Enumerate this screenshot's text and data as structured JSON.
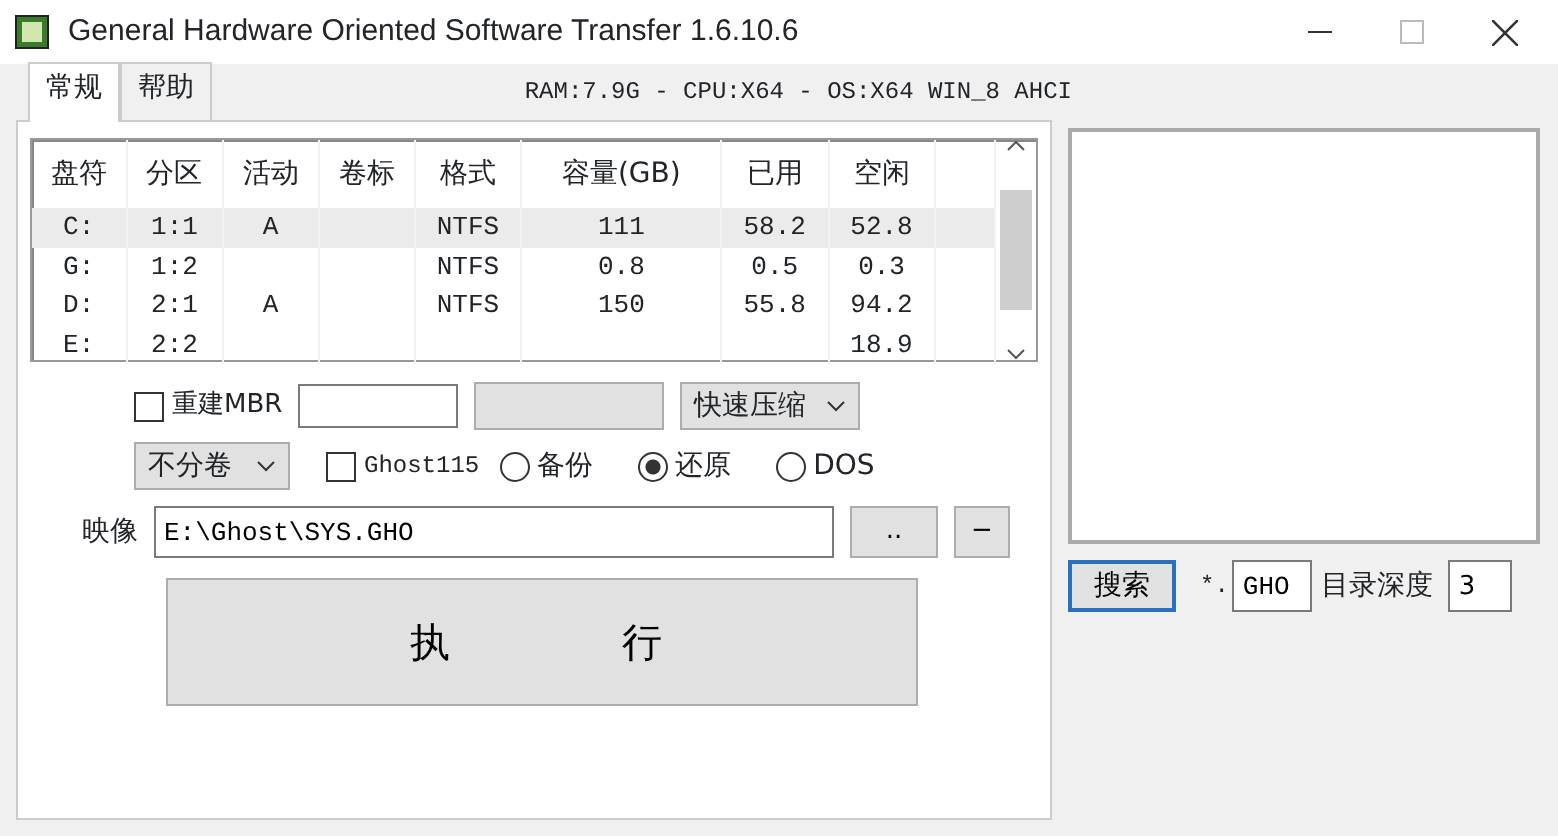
{
  "window": {
    "title": "General Hardware Oriented Software Transfer 1.6.10.6"
  },
  "tabs": [
    {
      "label": "常规",
      "selected": true
    },
    {
      "label": "帮助",
      "selected": false
    }
  ],
  "system_info": "RAM:7.9G - CPU:X64 - OS:X64 WIN_8 AHCI",
  "table": {
    "columns": [
      "盘符",
      "分区",
      "活动",
      "卷标",
      "格式",
      "容量(GB)",
      "已用",
      "空闲"
    ],
    "rows": [
      {
        "cells": [
          "C:",
          "1:1",
          "A",
          "",
          "NTFS",
          "111",
          "58.2",
          "52.8"
        ],
        "selected": true
      },
      {
        "cells": [
          "G:",
          "1:2",
          "",
          "",
          "NTFS",
          "0.8",
          "0.5",
          "0.3"
        ],
        "selected": false
      },
      {
        "cells": [
          "D:",
          "2:1",
          "A",
          "",
          "NTFS",
          "150",
          "55.8",
          "94.2"
        ],
        "selected": false
      },
      {
        "cells": [
          "E:",
          "2:2",
          "",
          "",
          "",
          "",
          "",
          "18.9"
        ],
        "selected": false
      }
    ]
  },
  "rebuild_mbr": {
    "label": "重建MBR",
    "checked": false
  },
  "compression": {
    "value": "快速压缩"
  },
  "split": {
    "value": "不分卷"
  },
  "ghost115": {
    "label": "Ghost115",
    "checked": false
  },
  "modes": [
    {
      "label": "备份",
      "selected": false
    },
    {
      "label": "还原",
      "selected": true
    },
    {
      "label": "DOS",
      "selected": false
    }
  ],
  "image": {
    "label": "映像",
    "value": "E:\\Ghost\\SYS.GHO",
    "browse": "..",
    "remove": "−"
  },
  "execute": "执 行",
  "search": {
    "button": "搜索",
    "prefix": "*.",
    "extension": "GHO",
    "depth_label": "目录深度",
    "depth": "3"
  }
}
